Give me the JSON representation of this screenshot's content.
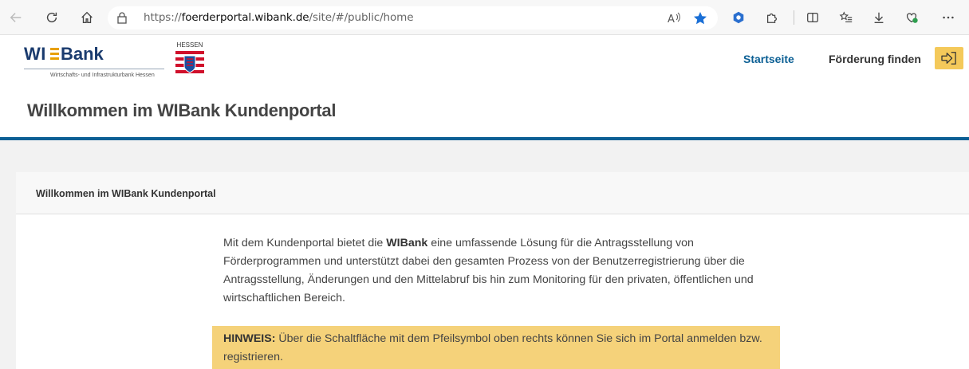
{
  "browser": {
    "url_prefix": "https://",
    "url_domain": "foerderportal.wibank.de",
    "url_path": "/site/#/public/home"
  },
  "site": {
    "logo_wi": "WI",
    "logo_bank": "Bank",
    "logo_subtitle": "Wirtschafts- und Infrastrukturbank Hessen",
    "state_label": "HESSEN",
    "nav": {
      "start": "Startseite",
      "find": "Förderung finden"
    }
  },
  "page": {
    "title": "Willkommen im WIBank Kundenportal",
    "card_title": "Willkommen im WIBank Kundenportal",
    "intro_before": "Mit dem Kundenportal bietet die ",
    "intro_bold": "WIBank",
    "intro_after": " eine umfassende Lösung für die Antragsstellung von Förderprogrammen und unterstützt dabei den gesamten Prozess von der Benutzerregistrierung über die Antragsstellung, Änderungen und den Mittelabruf bis hin zum Monitoring für den privaten, öffentlichen und wirtschaftlichen Bereich.",
    "hint_label": "HINWEIS:",
    "hint_text": " Über die Schaltfläche mit dem Pfeilsymbol oben rechts können Sie sich im Portal anmelden bzw. registrieren."
  },
  "colors": {
    "brand_blue": "#0b5f94",
    "hint_yellow": "#f5d27a",
    "login_yellow": "#f4c95a"
  }
}
